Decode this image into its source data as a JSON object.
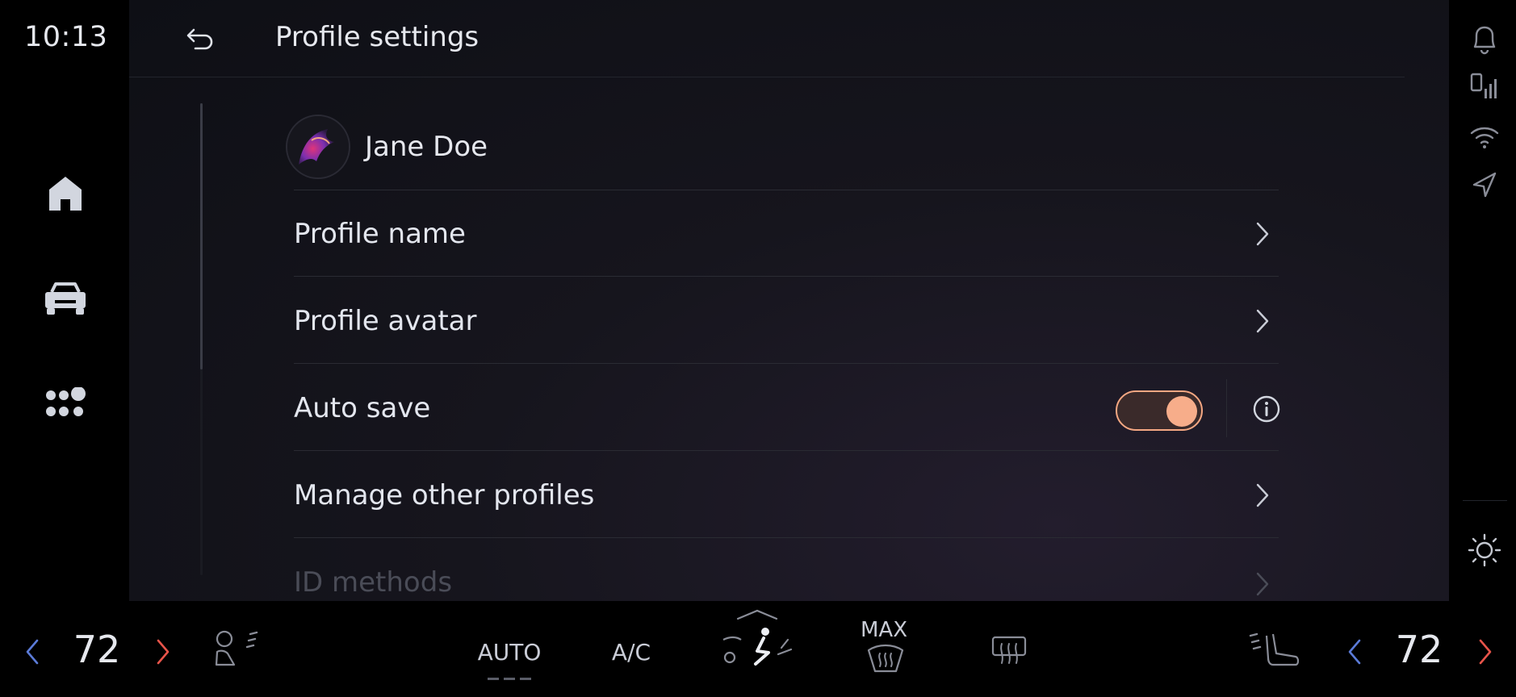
{
  "status": {
    "time": "10:13"
  },
  "header": {
    "title": "Profile settings"
  },
  "profile": {
    "name": "Jane Doe"
  },
  "rows": [
    {
      "label": "Profile name"
    },
    {
      "label": "Profile avatar"
    },
    {
      "label": "Auto save",
      "toggle_on": true
    },
    {
      "label": "Manage other profiles"
    },
    {
      "label": "ID methods"
    }
  ],
  "climate": {
    "left_temp": "72",
    "right_temp": "72",
    "auto_label": "AUTO",
    "ac_label": "A/C",
    "max_label": "MAX"
  },
  "colors": {
    "accent": "#f7ad8a",
    "left_arrow": "#5b7bd8",
    "right_arrow": "#e8544a"
  },
  "icons": [
    "back-arrow-icon",
    "home-icon",
    "car-icon",
    "apps-icon",
    "bell-icon",
    "phone-signal-icon",
    "wifi-icon",
    "navigation-icon",
    "brightness-icon",
    "chevron-right-icon",
    "info-icon",
    "steering-heat-icon",
    "seat-heat-icon",
    "airflow-icon",
    "max-defrost-icon",
    "rear-defrost-icon"
  ]
}
